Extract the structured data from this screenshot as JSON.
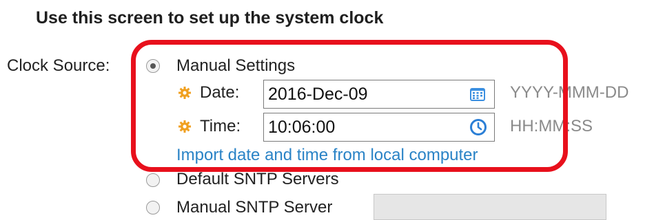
{
  "heading": "Use this screen to set up the system clock",
  "clock_source": {
    "label": "Clock Source:",
    "options": [
      {
        "label": "Manual Settings",
        "selected": true
      },
      {
        "label": "Default SNTP Servers",
        "selected": false
      },
      {
        "label": "Manual SNTP Server",
        "selected": false
      }
    ]
  },
  "manual": {
    "date": {
      "label": "Date:",
      "value": "2016-Dec-09",
      "format_hint": "YYYY-MMM-DD"
    },
    "time": {
      "label": "Time:",
      "value": "10:06:00",
      "format_hint": "HH:MM:SS"
    },
    "import_link": "Import date and time from local computer"
  },
  "manual_sntp_server_value": "",
  "colors": {
    "highlight": "#e8101c",
    "required_icon": "#f0a020",
    "link": "#2a83c6",
    "calendar_icon": "#3b8fe0",
    "clock_icon": "#2b7fd6"
  }
}
